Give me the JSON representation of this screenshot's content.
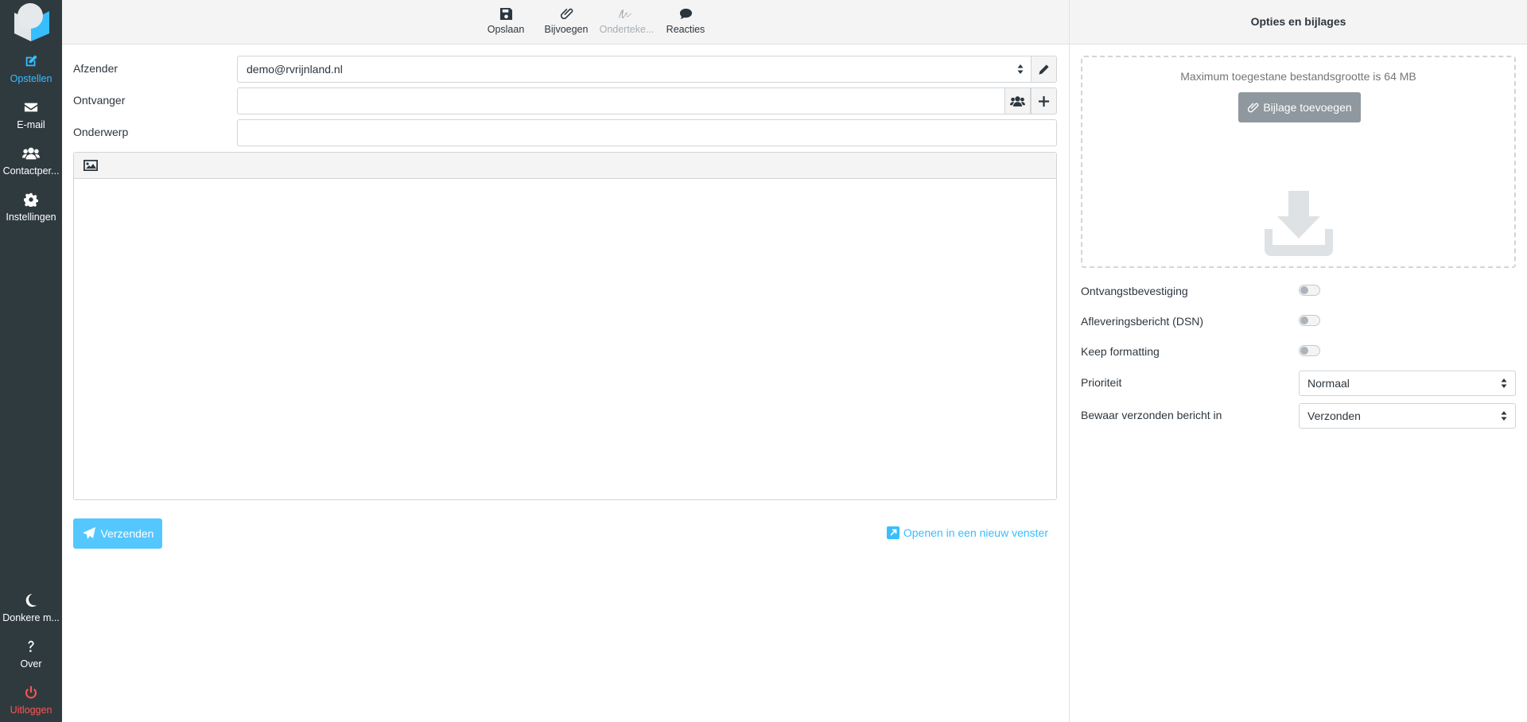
{
  "nav": {
    "items": [
      {
        "label": "Opstellen",
        "icon": "compose-icon",
        "active": true
      },
      {
        "label": "E-mail",
        "icon": "envelope-icon"
      },
      {
        "label": "Contactper...",
        "icon": "users-icon"
      },
      {
        "label": "Instellingen",
        "icon": "gear-icon"
      }
    ],
    "bottom": [
      {
        "label": "Donkere m...",
        "icon": "moon-icon"
      },
      {
        "label": "Over",
        "icon": "question-icon"
      },
      {
        "label": "Uitloggen",
        "icon": "power-icon"
      }
    ]
  },
  "toolbar": {
    "save": "Opslaan",
    "attach": "Bijvoegen",
    "signature": "Onderteke...",
    "responses": "Reacties"
  },
  "compose": {
    "from_label": "Afzender",
    "from_value": "demo@rvrijnland.nl",
    "to_label": "Ontvanger",
    "to_value": "",
    "subject_label": "Onderwerp",
    "subject_value": "",
    "send": "Verzenden",
    "open_new_window": "Openen in een nieuw venster"
  },
  "options": {
    "title": "Opties en bijlages",
    "max_size": "Maximum toegestane bestandsgrootte is 64 MB",
    "add_attachment": "Bijlage toevoegen",
    "receipt": "Ontvangstbevestiging",
    "dsn": "Afleveringsbericht (DSN)",
    "keep_formatting": "Keep formatting",
    "priority_label": "Prioriteit",
    "priority_value": "Normaal",
    "save_sent_label": "Bewaar verzonden bericht in",
    "save_sent_value": "Verzonden"
  },
  "colors": {
    "accent": "#37beff",
    "sidebar": "#2f3a3f",
    "logout": "#ff5552"
  }
}
